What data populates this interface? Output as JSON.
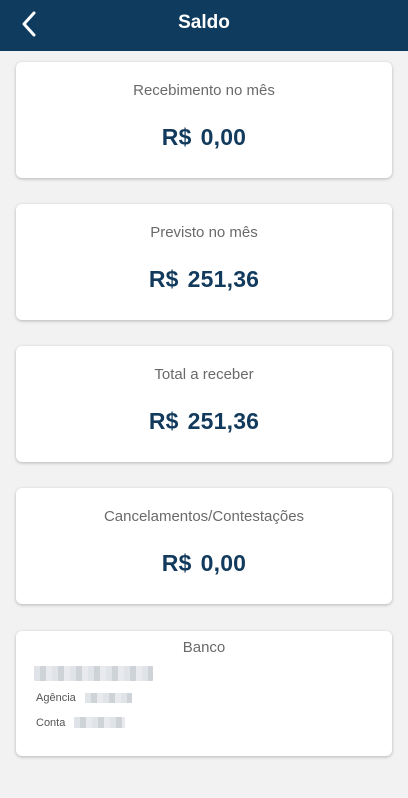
{
  "header": {
    "title": "Saldo",
    "back_icon": "chevron-left-icon",
    "background": "#0f3b5f"
  },
  "cards": [
    {
      "label": "Recebimento no mês",
      "currency": "R$",
      "amount": "0,00"
    },
    {
      "label": "Previsto no mês",
      "currency": "R$",
      "amount": "251,36"
    },
    {
      "label": "Total a receber",
      "currency": "R$",
      "amount": "251,36"
    },
    {
      "label": "Cancelamentos/Contestações",
      "currency": "R$",
      "amount": "0,00"
    }
  ],
  "bank": {
    "title": "Banco",
    "agencia_label": "Agência",
    "conta_label": "Conta"
  },
  "colors": {
    "value_text": "#123a5c",
    "label_text": "#6a6a6a",
    "background": "#f2f2f2"
  }
}
